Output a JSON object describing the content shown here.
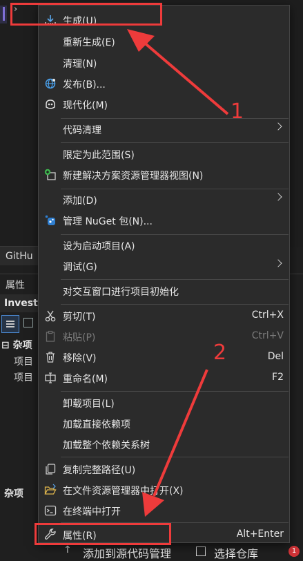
{
  "background": {
    "panel_tab": "GitHu",
    "properties_title": "属性",
    "project_name": "Invest",
    "category_1": "杂项",
    "item_1": "项目",
    "item_2": "项目",
    "category_2": "杂项",
    "status_source": "添加到源代码管理",
    "status_repo": "选择仓库",
    "notification_count": "1"
  },
  "menu": {
    "build": "生成(U)",
    "rebuild": "重新生成(E)",
    "clean": "清理(N)",
    "publish": "发布(B)...",
    "modernize": "现代化(M)",
    "code_cleanup": "代码清理",
    "scope": "限定为此范围(S)",
    "new_view": "新建解决方案资源管理器视图(N)",
    "add": "添加(D)",
    "nuget": "管理 NuGet 包(N)...",
    "startup": "设为启动项目(A)",
    "debug": "调试(G)",
    "interactive": "对交互窗口进行项目初始化",
    "cut": "剪切(T)",
    "cut_shortcut": "Ctrl+X",
    "paste": "粘贴(P)",
    "paste_shortcut": "Ctrl+V",
    "remove": "移除(V)",
    "remove_shortcut": "Del",
    "rename": "重命名(M)",
    "rename_shortcut": "F2",
    "unload": "卸载项目(L)",
    "load_direct": "加载直接依赖项",
    "load_tree": "加载整个依赖关系树",
    "copy_path": "复制完整路径(U)",
    "open_explorer": "在文件资源管理器中打开(X)",
    "open_terminal": "在终端中打开",
    "properties": "属性(R)",
    "properties_shortcut": "Alt+Enter"
  },
  "annotations": {
    "label_1": "1",
    "label_2": "2",
    "color": "#ee3b3b"
  }
}
